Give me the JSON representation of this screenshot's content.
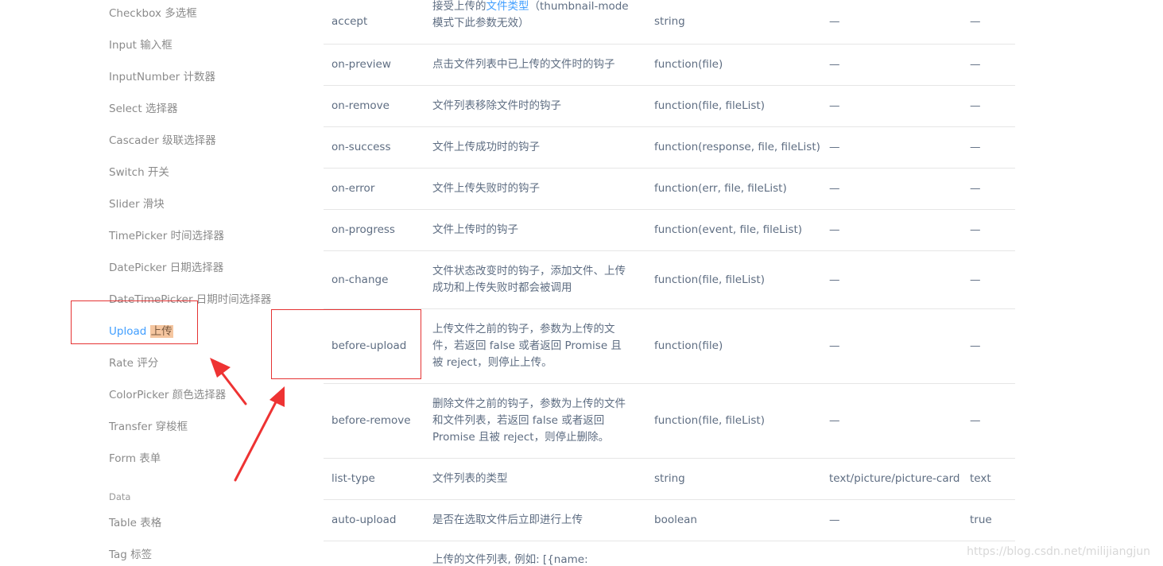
{
  "sidebar": {
    "items": [
      {
        "label": "Checkbox 多选框"
      },
      {
        "label": "Input 输入框"
      },
      {
        "label": "InputNumber 计数器"
      },
      {
        "label": "Select 选择器"
      },
      {
        "label": "Cascader 级联选择器"
      },
      {
        "label": "Switch 开关"
      },
      {
        "label": "Slider 滑块"
      },
      {
        "label": "TimePicker 时间选择器"
      },
      {
        "label": "DatePicker 日期选择器"
      },
      {
        "label": "DateTimePicker 日期时间选择器"
      },
      {
        "label_en": "Upload",
        "label_cn": "上传",
        "active": true
      },
      {
        "label": "Rate 评分"
      },
      {
        "label": "ColorPicker 颜色选择器"
      },
      {
        "label": "Transfer 穿梭框"
      },
      {
        "label": "Form 表单"
      }
    ],
    "group_data": "Data",
    "data_items": [
      {
        "label": "Table 表格"
      },
      {
        "label": "Tag 标签"
      }
    ]
  },
  "table": {
    "rows": [
      {
        "name": "accept",
        "desc_pre": "接受上传的",
        "desc_link": "文件类型",
        "desc_post": "（thumbnail-mode 模式下此参数无效）",
        "type": "string",
        "options": "—",
        "default": "—"
      },
      {
        "name": "on-preview",
        "desc": "点击文件列表中已上传的文件时的钩子",
        "type": "function(file)",
        "options": "—",
        "default": "—"
      },
      {
        "name": "on-remove",
        "desc": "文件列表移除文件时的钩子",
        "type": "function(file, fileList)",
        "options": "—",
        "default": "—"
      },
      {
        "name": "on-success",
        "desc": "文件上传成功时的钩子",
        "type": "function(response, file, fileList)",
        "options": "—",
        "default": "—"
      },
      {
        "name": "on-error",
        "desc": "文件上传失败时的钩子",
        "type": "function(err, file, fileList)",
        "options": "—",
        "default": "—"
      },
      {
        "name": "on-progress",
        "desc": "文件上传时的钩子",
        "type": "function(event, file, fileList)",
        "options": "—",
        "default": "—"
      },
      {
        "name": "on-change",
        "desc": "文件状态改变时的钩子，添加文件、上传成功和上传失败时都会被调用",
        "type": "function(file, fileList)",
        "options": "—",
        "default": "—"
      },
      {
        "name": "before-upload",
        "desc": "上传文件之前的钩子，参数为上传的文件，若返回 false 或者返回 Promise 且被 reject，则停止上传。",
        "type": "function(file)",
        "options": "—",
        "default": "—"
      },
      {
        "name": "before-remove",
        "desc": "删除文件之前的钩子，参数为上传的文件和文件列表，若返回 false 或者返回 Promise 且被 reject，则停止删除。",
        "type": "function(file, fileList)",
        "options": "—",
        "default": "—"
      },
      {
        "name": "list-type",
        "desc": "文件列表的类型",
        "type": "string",
        "options": "text/picture/picture-card",
        "default": "text"
      },
      {
        "name": "auto-upload",
        "desc": "是否在选取文件后立即进行上传",
        "type": "boolean",
        "options": "—",
        "default": "true"
      },
      {
        "name": "",
        "desc": "上传的文件列表, 例如: [{name:",
        "type": "",
        "options": "",
        "default": ""
      }
    ]
  },
  "colors": {
    "accent": "#409eff",
    "annotation": "#e53333",
    "highlight": "#f5c6a0"
  },
  "watermark": "https://blog.csdn.net/milijiangjun"
}
